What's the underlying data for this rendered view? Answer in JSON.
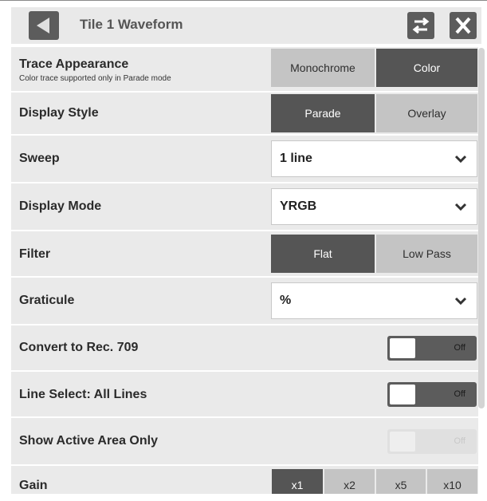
{
  "header": {
    "title": "Tile 1 Waveform"
  },
  "rows": {
    "trace": {
      "label": "Trace Appearance",
      "sub": "Color trace supported only in Parade mode",
      "opt1": "Monochrome",
      "opt2": "Color"
    },
    "display_style": {
      "label": "Display Style",
      "opt1": "Parade",
      "opt2": "Overlay"
    },
    "sweep": {
      "label": "Sweep",
      "value": "1 line"
    },
    "display_mode": {
      "label": "Display Mode",
      "value": "YRGB"
    },
    "filter": {
      "label": "Filter",
      "opt1": "Flat",
      "opt2": "Low Pass"
    },
    "graticule": {
      "label": "Graticule",
      "value": "%"
    },
    "convert": {
      "label": "Convert to Rec. 709",
      "state": "Off"
    },
    "line_select": {
      "label": "Line Select: All Lines",
      "state": "Off"
    },
    "active_area": {
      "label": "Show Active Area Only",
      "state": "Off"
    },
    "gain": {
      "label": "Gain",
      "opt1": "x1",
      "opt2": "x2",
      "opt3": "x5",
      "opt4": "x10"
    }
  }
}
